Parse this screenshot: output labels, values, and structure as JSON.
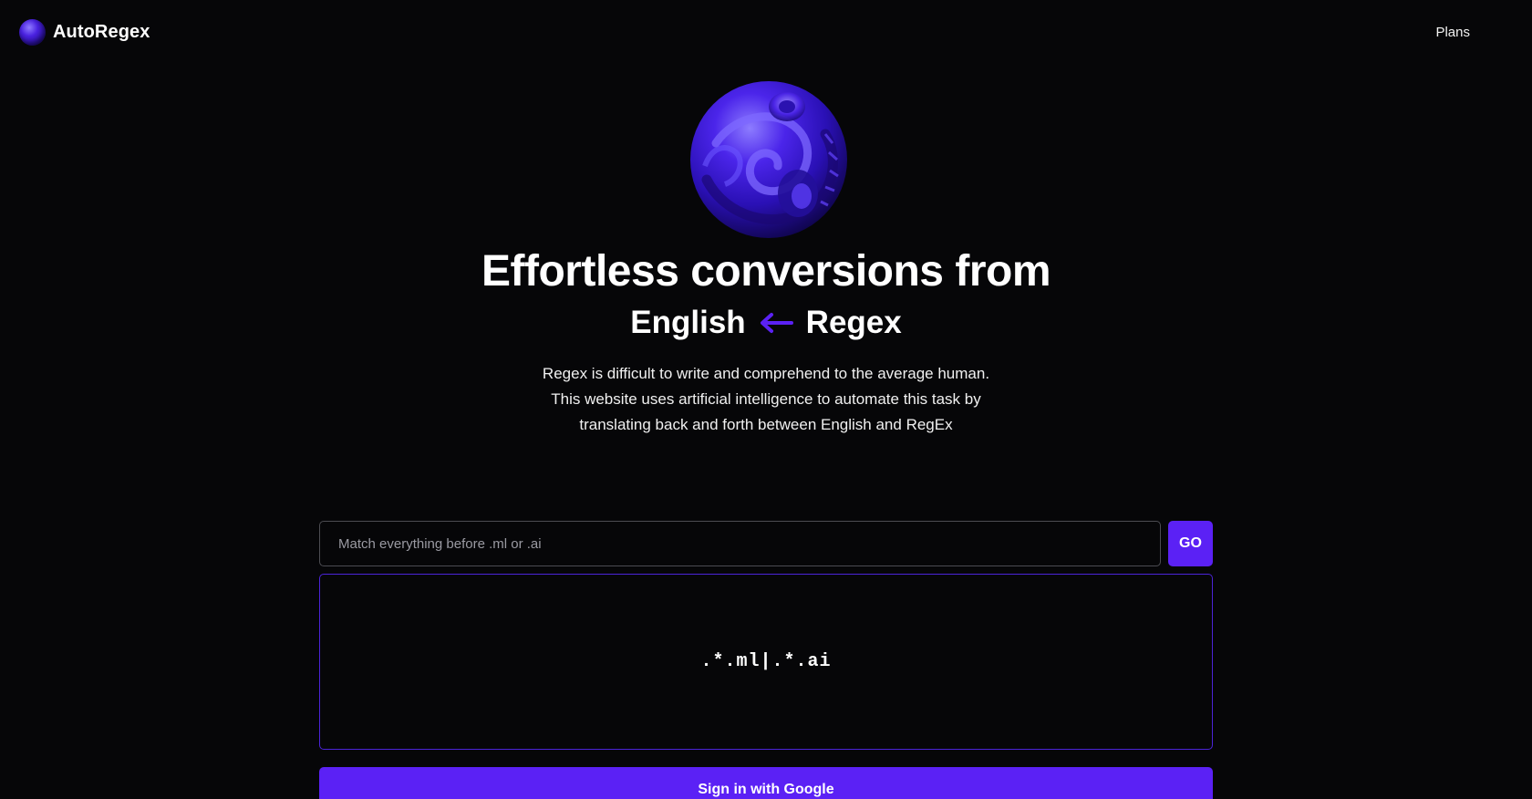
{
  "brand": {
    "name": "AutoRegex",
    "icon": "orb-logo-icon"
  },
  "nav": {
    "plans": "Plans"
  },
  "hero": {
    "title": "Effortless conversions from",
    "from_label": "English",
    "arrow_icon": "arrow-left-icon",
    "to_label": "Regex",
    "description": "Regex is difficult to write and comprehend to the average human. This website uses artificial intelligence to automate this task by translating back and forth between English and RegEx"
  },
  "converter": {
    "input_placeholder": "Match everything before .ml or .ai",
    "input_value": "",
    "go_label": "GO",
    "output": ".*.ml|.*.ai"
  },
  "auth": {
    "signin_label": "Sign in with Google"
  },
  "colors": {
    "background": "#060608",
    "accent": "#5b21f5",
    "output_border": "#4b23d8",
    "input_border": "#4c4c52"
  }
}
